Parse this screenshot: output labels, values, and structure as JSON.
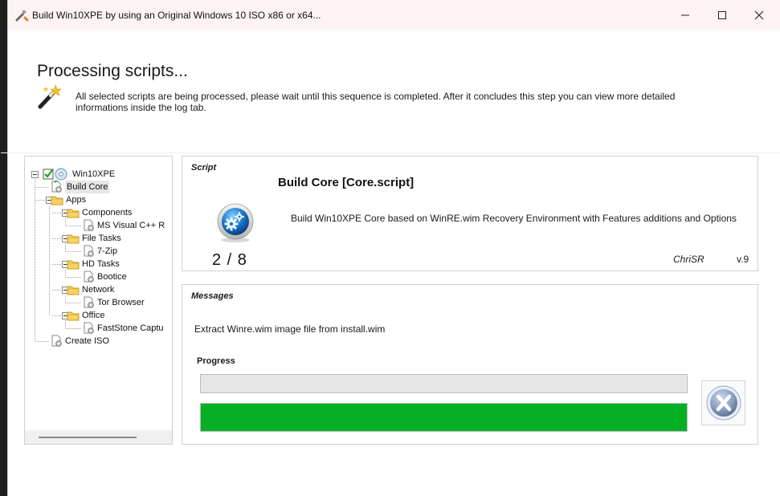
{
  "window": {
    "title": "Build Win10XPE by using an Original Windows 10 ISO x86 or x64...",
    "controls": [
      "minimize",
      "maximize",
      "close"
    ]
  },
  "header": {
    "title": "Processing scripts...",
    "description": "All selected scripts are being processed, please wait until this sequence is completed. After it concludes this step you can view more detailed informations inside the log tab."
  },
  "tree": {
    "root": "Win10XPE",
    "items": [
      {
        "label": "Build Core",
        "type": "script",
        "selected": true
      },
      {
        "label": "Apps",
        "type": "folder"
      },
      {
        "label": "Components",
        "type": "folder"
      },
      {
        "label": "MS Visual C++ R",
        "type": "script"
      },
      {
        "label": "File Tasks",
        "type": "folder"
      },
      {
        "label": "7-Zip",
        "type": "script"
      },
      {
        "label": "HD Tasks",
        "type": "folder"
      },
      {
        "label": "Bootice",
        "type": "script"
      },
      {
        "label": "Network",
        "type": "folder"
      },
      {
        "label": "Tor Browser",
        "type": "script"
      },
      {
        "label": "Office",
        "type": "folder"
      },
      {
        "label": "FastStone Captu",
        "type": "script"
      },
      {
        "label": "Create ISO",
        "type": "script"
      }
    ]
  },
  "script": {
    "section_label": "Script",
    "name": "Build Core [Core.script]",
    "description": "Build Win10XPE Core based on WinRE.wim Recovery Environment with Features additions and Options",
    "step": "2 / 8",
    "author": "ChriSR",
    "version": "v.9"
  },
  "messages": {
    "section_label": "Messages",
    "text": "Extract Winre.wim image file from install.wim",
    "progress_label": "Progress",
    "progress_top": 0,
    "progress_bottom": 1.0
  },
  "colors": {
    "progress_fill": "#06b025",
    "title_bar": "#fdf3f3"
  },
  "icons": {
    "app": "wrench-icon",
    "header": "magic-wand-icon",
    "script": "gear-icon",
    "cancel": "cancel-x-icon"
  }
}
